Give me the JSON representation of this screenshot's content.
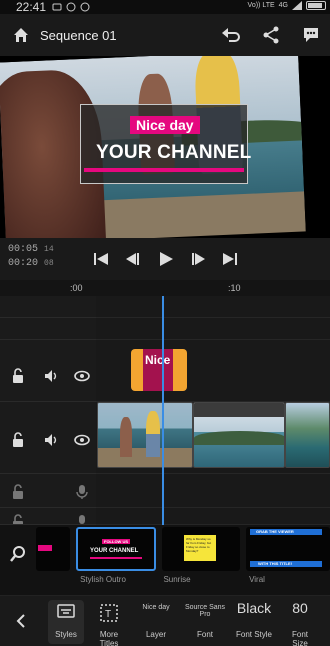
{
  "status_bar": {
    "time": "22:41",
    "network": "Vo)) LTE",
    "signal": "4G"
  },
  "header": {
    "title": "Sequence 01",
    "icons": [
      "home-icon",
      "undo-icon",
      "share-icon",
      "feedback-icon"
    ]
  },
  "preview": {
    "title_line1": "Nice day",
    "title_line2": "YOUR CHANNEL"
  },
  "transport": {
    "current_time": "00:05",
    "current_frame": "14",
    "total_time": "00:20",
    "total_frame": "08"
  },
  "timeline": {
    "ruler_marks": [
      ":00",
      ":10"
    ],
    "title_clip_label": "Nice",
    "tracks": [
      "title-track",
      "video-track",
      "audio-track-1",
      "audio-track-2"
    ]
  },
  "picker": {
    "items": [
      {
        "name": "",
        "caption": ""
      },
      {
        "name": "Stylish Outro",
        "caption": "YOUR CHANNEL",
        "tag": "FOLLOW US"
      },
      {
        "name": "Sunrise",
        "caption": "Why is Monday so far from Friday, but Friday so close to Monday?"
      },
      {
        "name": "Viral",
        "caption": "GRAB THE VIEWER",
        "caption2": "WITH THIS TITLE!"
      }
    ]
  },
  "toolbar": {
    "styles_label": "Styles",
    "more_titles_label": "More Titles",
    "layer_value": "Nice day",
    "layer_label": "Layer",
    "font_value": "Source Sans Pro",
    "font_label": "Font",
    "font_style_value": "Black",
    "font_style_label": "Font Style",
    "font_size_value": "80",
    "font_size_label": "Font Size"
  },
  "colors": {
    "accent": "#3a8de4",
    "brand_pink": "#e5087f",
    "title_clip": "#f3a531"
  }
}
